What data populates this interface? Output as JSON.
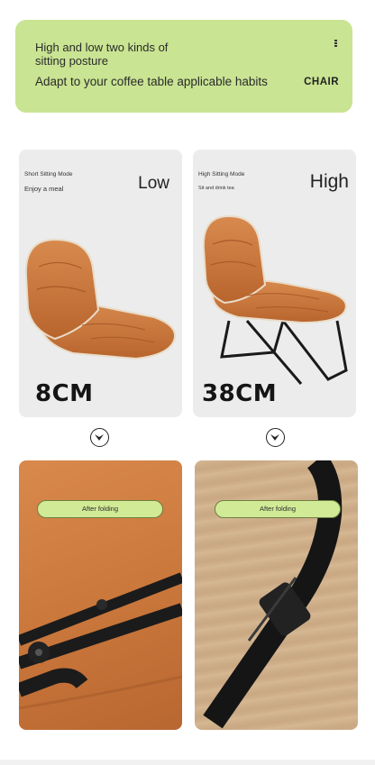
{
  "banner": {
    "line1": "High and low two kinds of sitting posture",
    "line2": "Adapt to your coffee table applicable habits",
    "brand": "CHAIR"
  },
  "cards": [
    {
      "mode": "Short Sitting Mode",
      "sub": "Enjoy a meal",
      "level": "Low",
      "height": "8CM"
    },
    {
      "mode": "High Sitting Mode",
      "sub": "Sit and drink tea",
      "level": "High",
      "height": "38CM"
    }
  ],
  "photos": [
    {
      "label": "After folding"
    },
    {
      "label": "After folding"
    }
  ],
  "icons": [
    "chevron-down-circle-icon",
    "chevron-down-circle-icon"
  ],
  "colors": {
    "banner": "#c9e492",
    "pill": "#d1ea96",
    "leather": "#c8733a"
  }
}
